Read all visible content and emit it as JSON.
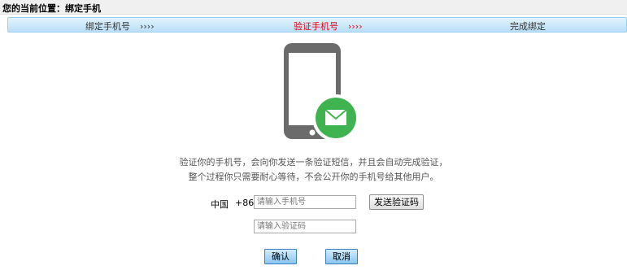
{
  "breadcrumb": {
    "text": "您的当前位置：绑定手机"
  },
  "steps": [
    {
      "label": "绑定手机号",
      "arrows": "››››",
      "active": false
    },
    {
      "label": "验证手机号",
      "arrows": "››››",
      "active": true
    },
    {
      "label": "完成绑定",
      "active": false
    }
  ],
  "colors": {
    "active_step": "#e60012",
    "envelope_badge": "#3fb34f",
    "phone_body": "#6b6b6b"
  },
  "icons": {
    "illustration": "phone-sms-icon"
  },
  "description": {
    "line1": "验证你的手机号，会向你发送一条验证短信，并且会自动完成验证，",
    "line2": "整个过程你只需要耐心等待，不会公开你的手机号给其他用户。"
  },
  "form": {
    "country": "中国",
    "country_code": "+86",
    "phone_placeholder": "请输入手机号",
    "send_code_label": "发送验证码",
    "code_placeholder": "请输入验证码"
  },
  "actions": {
    "confirm": "确认",
    "cancel": "取消"
  }
}
